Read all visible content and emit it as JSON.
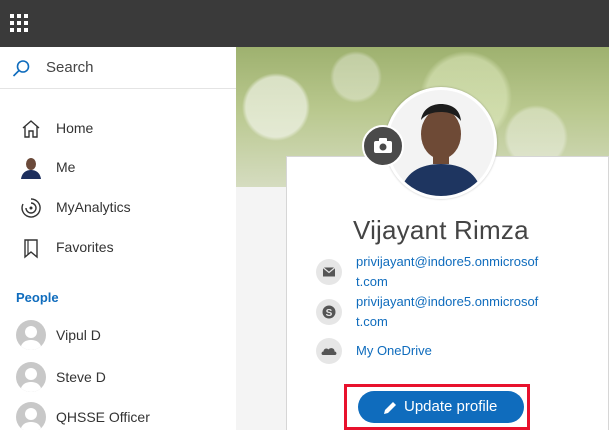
{
  "topbar": {
    "app_launcher_icon": "waffle-icon"
  },
  "search": {
    "placeholder": "Search",
    "icon": "search-icon"
  },
  "nav": [
    {
      "label": "Home",
      "icon": "home-icon"
    },
    {
      "label": "Me",
      "icon": "avatar"
    },
    {
      "label": "MyAnalytics",
      "icon": "analytics-icon"
    },
    {
      "label": "Favorites",
      "icon": "bookmark-icon"
    }
  ],
  "people": {
    "title": "People",
    "items": [
      {
        "name": "Vipul D"
      },
      {
        "name": "Steve D"
      },
      {
        "name": "QHSSE Officer"
      }
    ]
  },
  "profile": {
    "name": "Vijayant Rimza",
    "email_line1": "privijayant@indore5.onmicrosof",
    "email_line2": "t.com",
    "skype_line1": "privijayant@indore5.onmicrosof",
    "skype_line2": "t.com",
    "onedrive": "My OneDrive",
    "update_button": "Update profile"
  },
  "colors": {
    "accent": "#0f6cbd",
    "highlight": "#e8112d",
    "topbar": "#3a3a3a"
  }
}
